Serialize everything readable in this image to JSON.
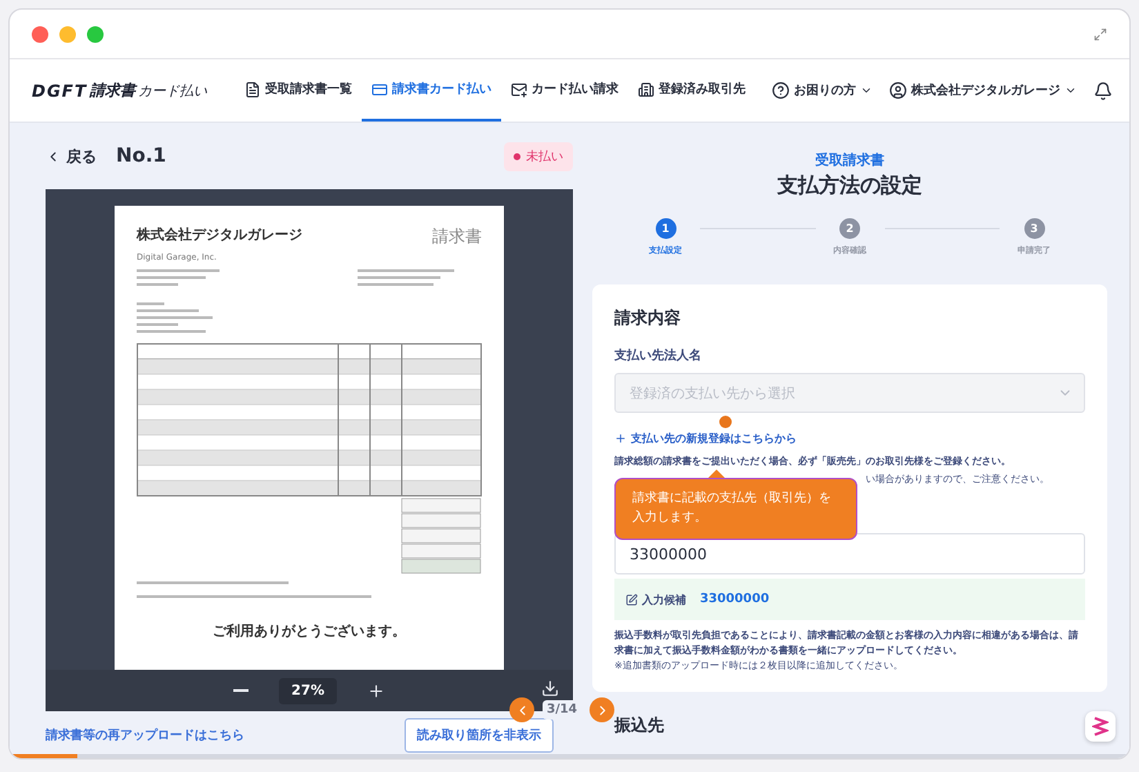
{
  "brand": {
    "mark": "DGFT",
    "name": "請求書",
    "sub": "カード払い"
  },
  "nav": [
    {
      "label": "受取請求書一覧",
      "selected": false
    },
    {
      "label": "請求書カード払い",
      "selected": true
    },
    {
      "label": "カード払い請求",
      "selected": false
    },
    {
      "label": "登録済み取引先",
      "selected": false
    }
  ],
  "help": "お困りの方",
  "account": "株式会社デジタルガレージ",
  "left": {
    "back": "戻る",
    "title": "No.1",
    "status": "未払い",
    "document": {
      "company": "株式会社デジタルガレージ",
      "company_en": "Digital Garage, Inc.",
      "doc_title": "請求書",
      "thanks": "ご利用ありがとうございます。"
    },
    "zoom": "27%",
    "reupload": "請求書等の再アップロードはこちら",
    "hide_button": "読み取り箇所を非表示"
  },
  "right": {
    "eyebrow": "受取請求書",
    "title": "支払方法の設定",
    "steps": [
      {
        "number": "1",
        "label": "支払設定",
        "selected": true
      },
      {
        "number": "2",
        "label": "内容確認",
        "selected": false
      },
      {
        "number": "3",
        "label": "申請完了",
        "selected": false
      }
    ],
    "card": {
      "heading": "請求内容",
      "payee_label": "支払い先法人名",
      "payee_placeholder": "登録済の支払い先から選択",
      "add_link": "支払い先の新規登録はこちらから",
      "note_1": "請求総額の請求書をご提出いただく場合、必ず「販売先」のお取引先様をご登録ください。",
      "note_2": "い場合がありますので、ご注意ください。",
      "amount_value": "33000000",
      "suggest_label": "入力候補",
      "suggest_value": "33000000",
      "fee_note": "振込手数料が取引先負担であることにより、請求書記載の金額とお客様の入力内容に相違がある場合は、請求書に加えて振込手数料金額がわかる書類を一緒にアップロードしてください。",
      "extra_note": "※追加書類のアップロード時には２枚目以降に追加してください。"
    },
    "next_section": "振込先"
  },
  "walkthrough": {
    "tooltip": "請求書に記載の支払先（取引先）を入力します。",
    "pager": "3/14",
    "level": 0.06
  }
}
